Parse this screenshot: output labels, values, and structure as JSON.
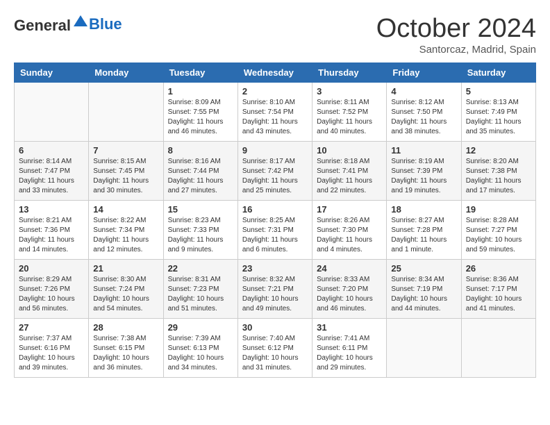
{
  "logo": {
    "general": "General",
    "blue": "Blue"
  },
  "title": "October 2024",
  "subtitle": "Santorcaz, Madrid, Spain",
  "days_of_week": [
    "Sunday",
    "Monday",
    "Tuesday",
    "Wednesday",
    "Thursday",
    "Friday",
    "Saturday"
  ],
  "weeks": [
    [
      {
        "day": "",
        "info": ""
      },
      {
        "day": "",
        "info": ""
      },
      {
        "day": "1",
        "info": "Sunrise: 8:09 AM\nSunset: 7:55 PM\nDaylight: 11 hours and 46 minutes."
      },
      {
        "day": "2",
        "info": "Sunrise: 8:10 AM\nSunset: 7:54 PM\nDaylight: 11 hours and 43 minutes."
      },
      {
        "day": "3",
        "info": "Sunrise: 8:11 AM\nSunset: 7:52 PM\nDaylight: 11 hours and 40 minutes."
      },
      {
        "day": "4",
        "info": "Sunrise: 8:12 AM\nSunset: 7:50 PM\nDaylight: 11 hours and 38 minutes."
      },
      {
        "day": "5",
        "info": "Sunrise: 8:13 AM\nSunset: 7:49 PM\nDaylight: 11 hours and 35 minutes."
      }
    ],
    [
      {
        "day": "6",
        "info": "Sunrise: 8:14 AM\nSunset: 7:47 PM\nDaylight: 11 hours and 33 minutes."
      },
      {
        "day": "7",
        "info": "Sunrise: 8:15 AM\nSunset: 7:45 PM\nDaylight: 11 hours and 30 minutes."
      },
      {
        "day": "8",
        "info": "Sunrise: 8:16 AM\nSunset: 7:44 PM\nDaylight: 11 hours and 27 minutes."
      },
      {
        "day": "9",
        "info": "Sunrise: 8:17 AM\nSunset: 7:42 PM\nDaylight: 11 hours and 25 minutes."
      },
      {
        "day": "10",
        "info": "Sunrise: 8:18 AM\nSunset: 7:41 PM\nDaylight: 11 hours and 22 minutes."
      },
      {
        "day": "11",
        "info": "Sunrise: 8:19 AM\nSunset: 7:39 PM\nDaylight: 11 hours and 19 minutes."
      },
      {
        "day": "12",
        "info": "Sunrise: 8:20 AM\nSunset: 7:38 PM\nDaylight: 11 hours and 17 minutes."
      }
    ],
    [
      {
        "day": "13",
        "info": "Sunrise: 8:21 AM\nSunset: 7:36 PM\nDaylight: 11 hours and 14 minutes."
      },
      {
        "day": "14",
        "info": "Sunrise: 8:22 AM\nSunset: 7:34 PM\nDaylight: 11 hours and 12 minutes."
      },
      {
        "day": "15",
        "info": "Sunrise: 8:23 AM\nSunset: 7:33 PM\nDaylight: 11 hours and 9 minutes."
      },
      {
        "day": "16",
        "info": "Sunrise: 8:25 AM\nSunset: 7:31 PM\nDaylight: 11 hours and 6 minutes."
      },
      {
        "day": "17",
        "info": "Sunrise: 8:26 AM\nSunset: 7:30 PM\nDaylight: 11 hours and 4 minutes."
      },
      {
        "day": "18",
        "info": "Sunrise: 8:27 AM\nSunset: 7:28 PM\nDaylight: 11 hours and 1 minute."
      },
      {
        "day": "19",
        "info": "Sunrise: 8:28 AM\nSunset: 7:27 PM\nDaylight: 10 hours and 59 minutes."
      }
    ],
    [
      {
        "day": "20",
        "info": "Sunrise: 8:29 AM\nSunset: 7:26 PM\nDaylight: 10 hours and 56 minutes."
      },
      {
        "day": "21",
        "info": "Sunrise: 8:30 AM\nSunset: 7:24 PM\nDaylight: 10 hours and 54 minutes."
      },
      {
        "day": "22",
        "info": "Sunrise: 8:31 AM\nSunset: 7:23 PM\nDaylight: 10 hours and 51 minutes."
      },
      {
        "day": "23",
        "info": "Sunrise: 8:32 AM\nSunset: 7:21 PM\nDaylight: 10 hours and 49 minutes."
      },
      {
        "day": "24",
        "info": "Sunrise: 8:33 AM\nSunset: 7:20 PM\nDaylight: 10 hours and 46 minutes."
      },
      {
        "day": "25",
        "info": "Sunrise: 8:34 AM\nSunset: 7:19 PM\nDaylight: 10 hours and 44 minutes."
      },
      {
        "day": "26",
        "info": "Sunrise: 8:36 AM\nSunset: 7:17 PM\nDaylight: 10 hours and 41 minutes."
      }
    ],
    [
      {
        "day": "27",
        "info": "Sunrise: 7:37 AM\nSunset: 6:16 PM\nDaylight: 10 hours and 39 minutes."
      },
      {
        "day": "28",
        "info": "Sunrise: 7:38 AM\nSunset: 6:15 PM\nDaylight: 10 hours and 36 minutes."
      },
      {
        "day": "29",
        "info": "Sunrise: 7:39 AM\nSunset: 6:13 PM\nDaylight: 10 hours and 34 minutes."
      },
      {
        "day": "30",
        "info": "Sunrise: 7:40 AM\nSunset: 6:12 PM\nDaylight: 10 hours and 31 minutes."
      },
      {
        "day": "31",
        "info": "Sunrise: 7:41 AM\nSunset: 6:11 PM\nDaylight: 10 hours and 29 minutes."
      },
      {
        "day": "",
        "info": ""
      },
      {
        "day": "",
        "info": ""
      }
    ]
  ]
}
